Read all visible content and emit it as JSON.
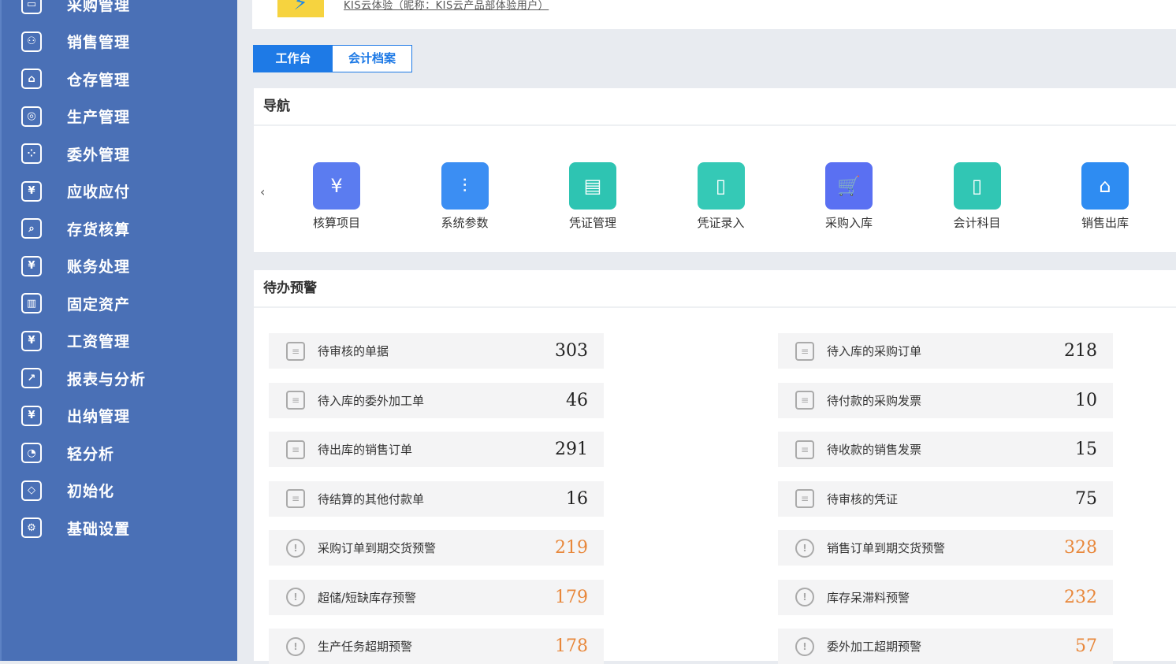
{
  "sidebar": {
    "items": [
      {
        "label": "采购管理",
        "icon": "purchase-icon",
        "glyph": "▭"
      },
      {
        "label": "销售管理",
        "icon": "users-icon",
        "glyph": "⚇"
      },
      {
        "label": "仓存管理",
        "icon": "warehouse-icon",
        "glyph": "⌂"
      },
      {
        "label": "生产管理",
        "icon": "hexagon-icon",
        "glyph": "◎"
      },
      {
        "label": "委外管理",
        "icon": "grid-icon",
        "glyph": "⁘"
      },
      {
        "label": "应收应付",
        "icon": "yen-icon",
        "glyph": "¥"
      },
      {
        "label": "存货核算",
        "icon": "house-search-icon",
        "glyph": "⌕"
      },
      {
        "label": "账务处理",
        "icon": "ledger-icon",
        "glyph": "¥"
      },
      {
        "label": "固定资产",
        "icon": "building-icon",
        "glyph": "▥"
      },
      {
        "label": "工资管理",
        "icon": "salary-icon",
        "glyph": "¥"
      },
      {
        "label": "报表与分析",
        "icon": "chart-icon",
        "glyph": "↗"
      },
      {
        "label": "出纳管理",
        "icon": "cashier-icon",
        "glyph": "¥"
      },
      {
        "label": "轻分析",
        "icon": "analysis-icon",
        "glyph": "◔"
      },
      {
        "label": "初始化",
        "icon": "init-icon",
        "glyph": "◇"
      },
      {
        "label": "基础设置",
        "icon": "settings-icon",
        "glyph": "⚙"
      }
    ]
  },
  "header": {
    "account": "KIS云体验（昵称：KIS云产品部体验用户）",
    "logo_glyph": "⚡"
  },
  "tabs": [
    {
      "label": "工作台"
    },
    {
      "label": "会计档案"
    }
  ],
  "nav": {
    "title": "导航",
    "prev": "‹",
    "items": [
      {
        "label": "核算项目",
        "glyph": "¥",
        "color": "#5b7cf0"
      },
      {
        "label": "系统参数",
        "glyph": "⫶",
        "color": "#3b8ef3"
      },
      {
        "label": "凭证管理",
        "glyph": "▤",
        "color": "#2ec4b2"
      },
      {
        "label": "凭证录入",
        "glyph": "▯",
        "color": "#35c9b6"
      },
      {
        "label": "采购入库",
        "glyph": "🛒",
        "color": "#5a70f2"
      },
      {
        "label": "会计科目",
        "glyph": "▯",
        "color": "#31c6b4"
      },
      {
        "label": "销售出库",
        "glyph": "⌂",
        "color": "#2e8cf2"
      }
    ]
  },
  "todo": {
    "title": "待办预警",
    "left": [
      {
        "label": "待审核的单据",
        "value": "303",
        "warn": false
      },
      {
        "label": "待入库的委外加工单",
        "value": "46",
        "warn": false
      },
      {
        "label": "待出库的销售订单",
        "value": "291",
        "warn": false
      },
      {
        "label": "待结算的其他付款单",
        "value": "16",
        "warn": false
      },
      {
        "label": "采购订单到期交货预警",
        "value": "219",
        "warn": true
      },
      {
        "label": "超储/短缺库存预警",
        "value": "179",
        "warn": true
      },
      {
        "label": "生产任务超期预警",
        "value": "178",
        "warn": true
      }
    ],
    "right": [
      {
        "label": "待入库的采购订单",
        "value": "218",
        "warn": false
      },
      {
        "label": "待付款的采购发票",
        "value": "10",
        "warn": false
      },
      {
        "label": "待收款的销售发票",
        "value": "15",
        "warn": false
      },
      {
        "label": "待审核的凭证",
        "value": "75",
        "warn": false
      },
      {
        "label": "销售订单到期交货预警",
        "value": "328",
        "warn": true
      },
      {
        "label": "库存呆滞料预警",
        "value": "232",
        "warn": true
      },
      {
        "label": "委外加工超期预警",
        "value": "57",
        "warn": true
      }
    ]
  },
  "colors": {
    "sidebar": "#4a70b6",
    "accent": "#1e7ae6",
    "warning": "#e8873a"
  }
}
